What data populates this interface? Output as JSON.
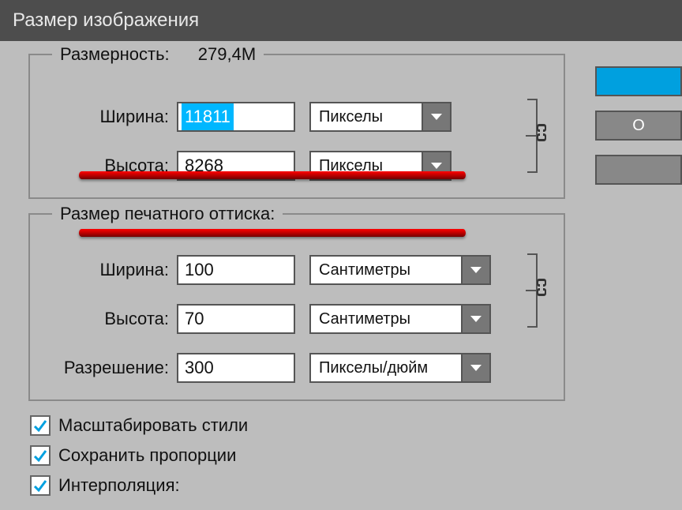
{
  "title": "Размер изображения",
  "dimensions": {
    "legend": "Размерность:",
    "value": "279,4M",
    "width_label": "Ширина:",
    "width_value": "11811",
    "height_label": "Высота:",
    "height_value": "8268",
    "unit": "Пикселы"
  },
  "print": {
    "legend": "Размер печатного оттиска:",
    "width_label": "Ширина:",
    "width_value": "100",
    "height_label": "Высота:",
    "height_value": "70",
    "unit": "Сантиметры",
    "res_label": "Разрешение:",
    "res_value": "300",
    "res_unit": "Пикселы/дюйм"
  },
  "checkboxes": {
    "scale_styles": "Масштабировать стили",
    "keep_ratio": "Сохранить пропорции",
    "interpolation": "Интерполяция:"
  },
  "buttons": {
    "ok": "",
    "cancel": "О"
  }
}
